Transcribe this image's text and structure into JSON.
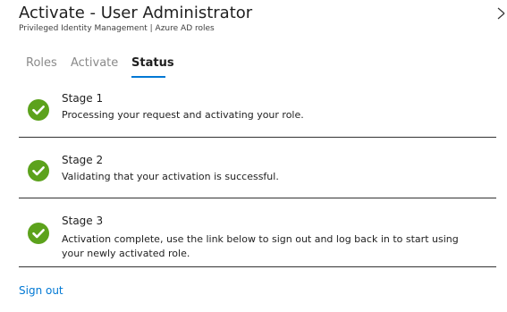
{
  "header": {
    "title": "Activate - User Administrator",
    "subtitle": "Privileged Identity Management | Azure AD roles"
  },
  "tabs": [
    {
      "label": "Roles"
    },
    {
      "label": "Activate"
    },
    {
      "label": "Status",
      "active": true
    }
  ],
  "stages": [
    {
      "title": "Stage 1",
      "description": "Processing your request and activating your role.",
      "status": "complete"
    },
    {
      "title": "Stage 2",
      "description": "Validating that your activation is successful.",
      "status": "complete"
    },
    {
      "title": "Stage 3",
      "description": "Activation complete, use the link below to sign out and log back in to start using your newly activated role.",
      "status": "complete"
    }
  ],
  "actions": {
    "sign_out": "Sign out"
  },
  "colors": {
    "accent": "#0078d4",
    "success": "#5ca21c"
  },
  "icons": {
    "close": "close-icon",
    "stage_status": "check-circle-icon"
  }
}
